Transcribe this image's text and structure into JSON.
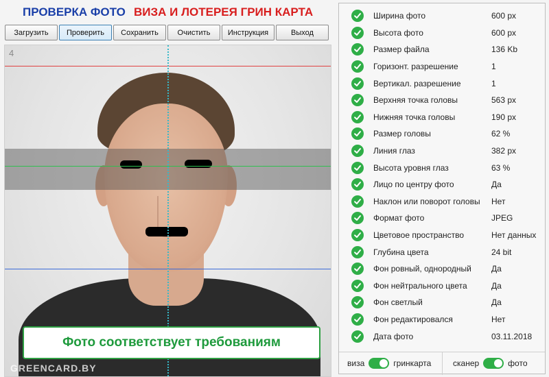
{
  "header": {
    "title_left": "ПРОВЕРКА ФОТО",
    "title_right": "ВИЗА И ЛОТЕРЕЯ ГРИН КАРТА"
  },
  "toolbar": {
    "buttons": [
      "Загрузить",
      "Проверить",
      "Сохранить",
      "Очистить",
      "Инструкция",
      "Выход"
    ]
  },
  "photo": {
    "frame_number": "4",
    "watermark": "GREENCARD.BY",
    "result": "Фото соответствует требованиям"
  },
  "checks": [
    {
      "label": "Ширина фото",
      "value": "600 px"
    },
    {
      "label": "Высота фото",
      "value": "600 px"
    },
    {
      "label": "Размер файла",
      "value": "136 Kb"
    },
    {
      "label": "Горизонт. разрешение",
      "value": "1"
    },
    {
      "label": "Вертикал. разрешение",
      "value": "1"
    },
    {
      "label": "Верхняя точка головы",
      "value": "563 px"
    },
    {
      "label": "Нижняя точка головы",
      "value": "190 px"
    },
    {
      "label": "Размер головы",
      "value": "62 %"
    },
    {
      "label": "Линия глаз",
      "value": "382 px"
    },
    {
      "label": "Высота уровня глаз",
      "value": "63 %"
    },
    {
      "label": "Лицо по центру фото",
      "value": "Да"
    },
    {
      "label": "Наклон или поворот головы",
      "value": "Нет"
    },
    {
      "label": "Формат фото",
      "value": "JPEG"
    },
    {
      "label": "Цветовое пространство",
      "value": "Нет данных"
    },
    {
      "label": "Глубина цвета",
      "value": "24 bit"
    },
    {
      "label": "Фон ровный, однородный",
      "value": "Да"
    },
    {
      "label": "Фон нейтрального цвета",
      "value": "Да"
    },
    {
      "label": "Фон светлый",
      "value": "Да"
    },
    {
      "label": "Фон редактировался",
      "value": "Нет"
    },
    {
      "label": "Дата фото",
      "value": "03.11.2018"
    }
  ],
  "toggles": {
    "mode": {
      "left": "виза",
      "right": "гринкарта"
    },
    "source": {
      "left": "сканер",
      "right": "фото"
    }
  },
  "colors": {
    "check_green": "#2fae47",
    "title_blue": "#1a3fa8",
    "title_red": "#d81e1e"
  }
}
